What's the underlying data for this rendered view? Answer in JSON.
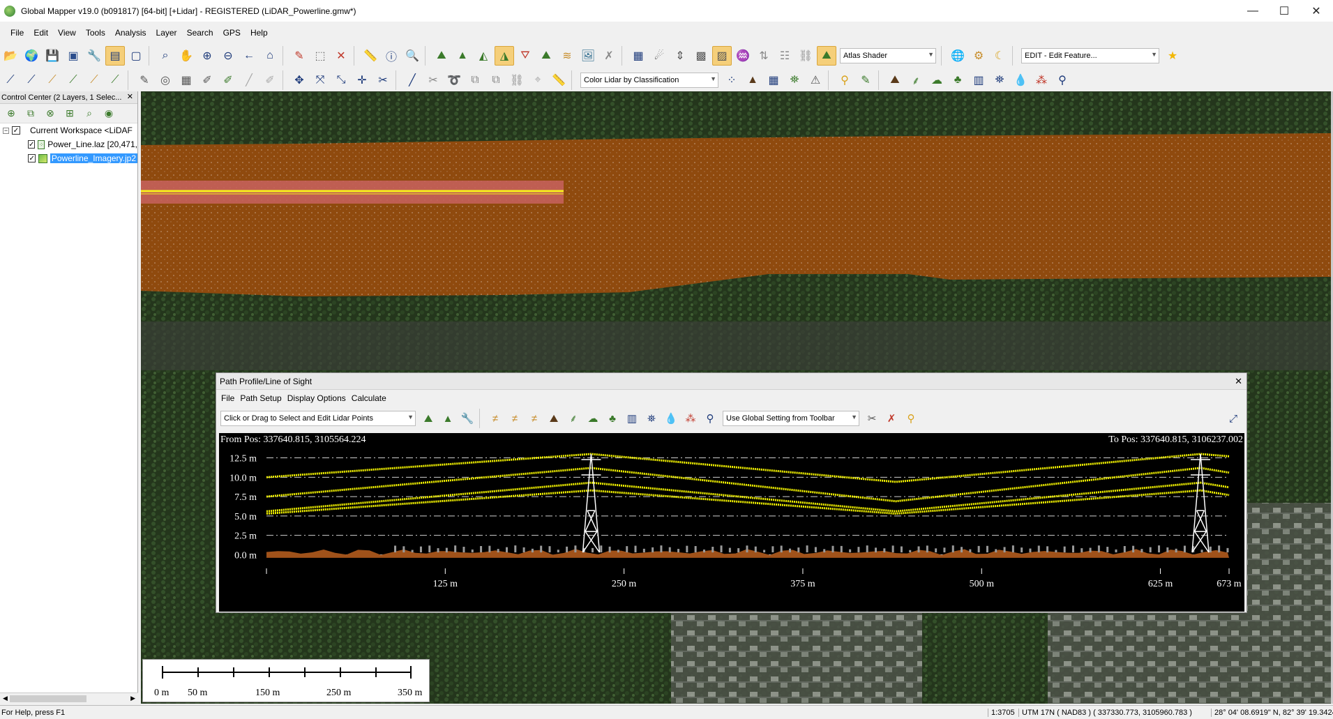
{
  "window": {
    "title": "Global Mapper v19.0 (b091817) [64-bit] [+Lidar] - REGISTERED (LiDAR_Powerline.gmw*)",
    "minimize": "—",
    "maximize": "☐",
    "close": "✕"
  },
  "menu": [
    "File",
    "Edit",
    "View",
    "Tools",
    "Analysis",
    "Layer",
    "Search",
    "GPS",
    "Help"
  ],
  "toolbar": {
    "shader_select": "Atlas Shader",
    "edit_select": "EDIT - Edit Feature...",
    "lidar_color_select": "Color Lidar by Classification"
  },
  "control_center": {
    "title": "Control Center (2 Layers, 1 Selec...",
    "close": "✕",
    "workspace": "Current Workspace <LiDAF",
    "layers": [
      {
        "name": "Power_Line.laz [20,471,",
        "checked": true,
        "selected": false
      },
      {
        "name": "Powerline_Imagery.jp2",
        "checked": true,
        "selected": true
      }
    ]
  },
  "profile": {
    "title": "Path Profile/Line of Sight",
    "close": "✕",
    "menu": [
      "File",
      "Path Setup",
      "Display Options",
      "Calculate"
    ],
    "select_mode": "Click or Drag to Select and Edit Lidar Points",
    "global_setting": "Use Global Setting from Toolbar",
    "from_pos": "From Pos: 337640.815, 3105564.224",
    "to_pos": "To Pos: 337640.815, 3106237.002"
  },
  "chart_data": {
    "type": "scatter",
    "xlabel": "",
    "ylabel": "",
    "x_ticks": [
      "125 m",
      "250 m",
      "375 m",
      "500 m",
      "625 m",
      "673 m"
    ],
    "x_tick_values": [
      125,
      250,
      375,
      500,
      625,
      673
    ],
    "y_ticks": [
      "0.0 m",
      "2.5 m",
      "5.0 m",
      "7.5 m",
      "10.0 m",
      "12.5 m"
    ],
    "y_tick_values": [
      0,
      2.5,
      5,
      7.5,
      10,
      12.5
    ],
    "xlim": [
      0,
      673
    ],
    "ylim": [
      -0.5,
      13
    ],
    "towers": [
      {
        "x": 227,
        "height": 13
      },
      {
        "x": 653,
        "height": 13
      }
    ],
    "conductors": [
      {
        "name": "",
        "x": [
          0,
          227,
          440,
          653,
          673
        ],
        "y": [
          10.0,
          13.0,
          9.4,
          13.0,
          12.7
        ]
      },
      {
        "name": "",
        "x": [
          0,
          227,
          440,
          653,
          673
        ],
        "y": [
          7.5,
          11.2,
          6.9,
          11.2,
          10.6
        ]
      },
      {
        "name": "",
        "x": [
          0,
          227,
          440,
          653,
          673
        ],
        "y": [
          5.6,
          9.3,
          5.6,
          9.3,
          8.7
        ]
      },
      {
        "name": "",
        "x": [
          0,
          227,
          440,
          653,
          673
        ],
        "y": [
          5.3,
          8.3,
          5.3,
          8.3,
          7.7
        ]
      }
    ],
    "ground": {
      "color": "#a0521a"
    },
    "grid": true,
    "colors": {
      "conductors": "#f2f200",
      "towers": "#ffffff",
      "ground": "#a0521a",
      "background": "#000000"
    }
  },
  "scalebar": {
    "labels": [
      "0 m",
      "50 m",
      "150 m",
      "250 m",
      "350 m"
    ]
  },
  "status": {
    "help": "For Help, press F1",
    "scale": "1:3705",
    "coords": "UTM 17N ( NAD83 ) ( 337330.773, 3105960.783 )",
    "latlon": "28° 04' 08.6919\" N, 82° 39' 19.3424\" W"
  }
}
